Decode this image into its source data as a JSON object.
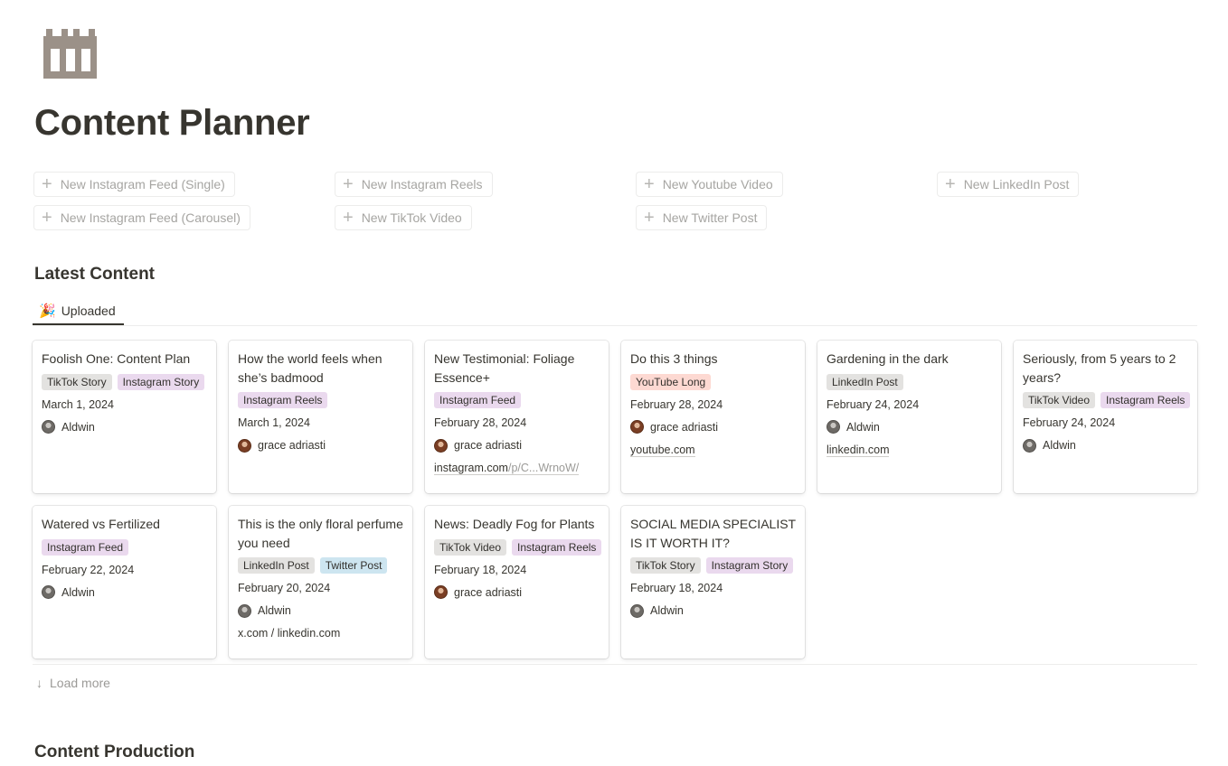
{
  "page": {
    "title": "Content Planner",
    "icon": "calendar-icon",
    "icon_color": "#9b9188"
  },
  "new_buttons": [
    {
      "label": "New Instagram Feed (Single)"
    },
    {
      "label": "New Instagram Reels"
    },
    {
      "label": "New Youtube Video"
    },
    {
      "label": "New LinkedIn Post"
    },
    {
      "label": "New Instagram Feed (Carousel)"
    },
    {
      "label": "New TikTok Video"
    },
    {
      "label": "New Twitter Post"
    }
  ],
  "latest": {
    "heading": "Latest Content",
    "tab_label": "Uploaded",
    "tab_icon": "party-popper-icon",
    "load_more": "Load more",
    "cards": [
      {
        "title": "Foolish One: Content Plan",
        "tags": [
          "TikTok Story",
          "Instagram Story"
        ],
        "date": "March 1, 2024",
        "person": "Aldwin",
        "link": ""
      },
      {
        "title": "How the world feels when she’s badmood",
        "tags": [
          "Instagram Reels"
        ],
        "date": "March 1, 2024",
        "person": "grace adriasti",
        "link": ""
      },
      {
        "title": "New Testimonial: Foliage Essence+",
        "tags": [
          "Instagram Feed"
        ],
        "date": "February 28, 2024",
        "person": "grace adriasti",
        "link": "instagram.com",
        "link_rest": "/p/C...WrnoW/"
      },
      {
        "title": "Do this 3 things",
        "tags": [
          "YouTube Long"
        ],
        "date": "February 28, 2024",
        "person": "grace adriasti",
        "link": "youtube.com"
      },
      {
        "title": "Gardening in the dark",
        "tags": [
          "LinkedIn Post"
        ],
        "date": "February 24, 2024",
        "person": "Aldwin",
        "link": "linkedin.com"
      },
      {
        "title": "Seriously, from 5 years to 2 years?",
        "tags": [
          "TikTok Video",
          "Instagram Reels"
        ],
        "date": "February 24, 2024",
        "person": "Aldwin",
        "link": ""
      },
      {
        "title": "Watered vs Fertilized",
        "tags": [
          "Instagram Feed"
        ],
        "date": "February 22, 2024",
        "person": "Aldwin",
        "link": ""
      },
      {
        "title": "This is the only floral perfume you need",
        "tags": [
          "LinkedIn Post",
          "Twitter Post"
        ],
        "date": "February 20, 2024",
        "person": "Aldwin",
        "link": "x.com / linkedin.com"
      },
      {
        "title": "News: Deadly Fog for Plants",
        "tags": [
          "TikTok Video",
          "Instagram Reels"
        ],
        "date": "February 18, 2024",
        "person": "grace adriasti",
        "link": ""
      },
      {
        "title": "SOCIAL MEDIA SPECIALIST IS IT WORTH IT?",
        "tags": [
          "TikTok Story",
          "Instagram Story"
        ],
        "date": "February 18, 2024",
        "person": "Aldwin",
        "link": ""
      }
    ]
  },
  "production": {
    "heading": "Content Production"
  },
  "tag_colors": {
    "TikTok Story": "#e3e2e0",
    "TikTok Video": "#e3e2e0",
    "LinkedIn Post": "#e3e2e0",
    "Instagram Story": "#ead9ee",
    "Instagram Reels": "#ead9ee",
    "Instagram Feed": "#ead9ee",
    "YouTube Long": "#fdd9d2",
    "Twitter Post": "#cde5f0"
  }
}
